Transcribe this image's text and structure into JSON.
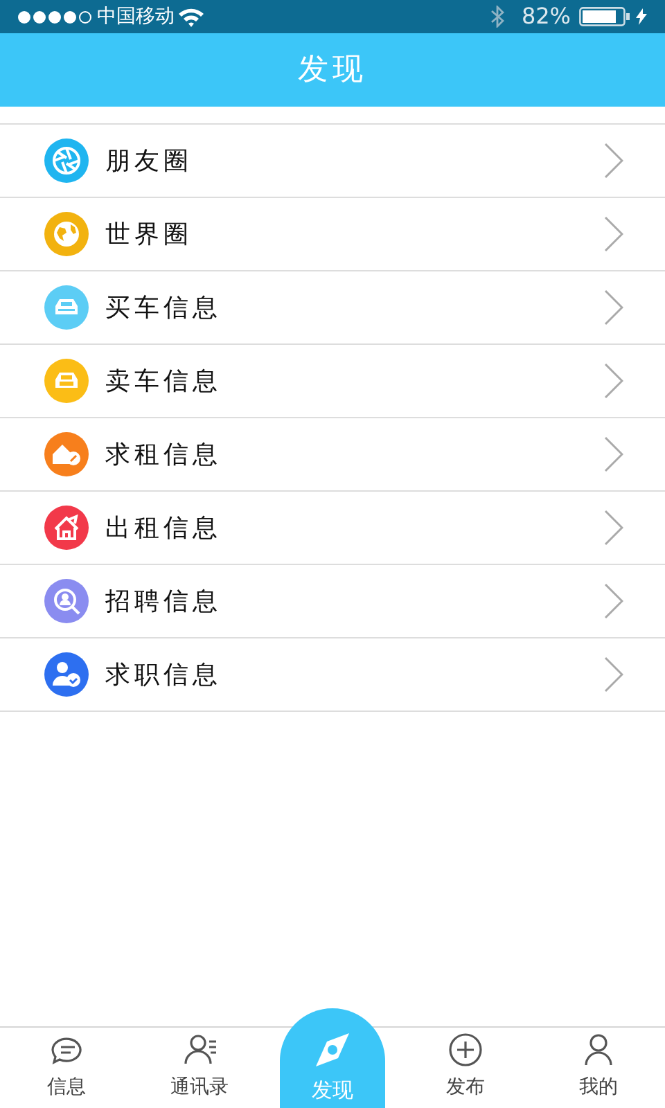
{
  "status_bar": {
    "carrier": "中国移动",
    "battery": "82%"
  },
  "nav_bar": {
    "title": "发现"
  },
  "items": [
    {
      "label": "朋友圈",
      "kind": "aperture",
      "color": "#1fb5f0"
    },
    {
      "label": "世界圈",
      "kind": "globe",
      "color": "#f2b20f"
    },
    {
      "label": "买车信息",
      "kind": "car",
      "color": "#5ccdf5"
    },
    {
      "label": "卖车信息",
      "kind": "car-sale",
      "color": "#fbbd16"
    },
    {
      "label": "求租信息",
      "kind": "house-key",
      "color": "#f77f1c"
    },
    {
      "label": "出租信息",
      "kind": "house-arrow",
      "color": "#f2394a"
    },
    {
      "label": "招聘信息",
      "kind": "search-person",
      "color": "#8a8cf0"
    },
    {
      "label": "求职信息",
      "kind": "person-check",
      "color": "#2d6ff0"
    }
  ],
  "tabs": [
    {
      "label": "信息",
      "kind": "chat",
      "selected": false
    },
    {
      "label": "通讯录",
      "kind": "contacts",
      "selected": false
    },
    {
      "label": "发现",
      "kind": "compass",
      "selected": true
    },
    {
      "label": "发布",
      "kind": "plus",
      "selected": false
    },
    {
      "label": "我的",
      "kind": "person",
      "selected": false
    }
  ]
}
